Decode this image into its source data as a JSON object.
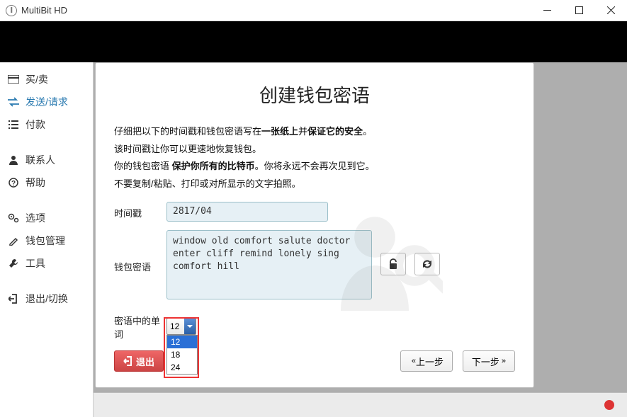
{
  "window": {
    "title": "MultiBit HD"
  },
  "sidebar": {
    "items": [
      {
        "label": "买/卖"
      },
      {
        "label": "发送/请求"
      },
      {
        "label": "付款"
      },
      {
        "label": "联系人"
      },
      {
        "label": "帮助"
      },
      {
        "label": "选项"
      },
      {
        "label": "钱包管理"
      },
      {
        "label": "工具"
      },
      {
        "label": "退出/切换"
      }
    ]
  },
  "dialog": {
    "title": "创建钱包密语",
    "instr1_a": "仔细把以下的时间戳和钱包密语写在",
    "instr1_b": "一张纸上",
    "instr1_c": "并",
    "instr1_d": "保证它的安全",
    "instr1_e": "。",
    "instr2": "该时间戳让你可以更速地恢复钱包。",
    "instr3_a": "你的钱包密语",
    "instr3_b": "保护你所有的比特币",
    "instr3_c": "。你将永远不会再次见到它。",
    "instr4": "不要复制/粘贴、打印或对所显示的文字拍照。",
    "timestamp_label": "时间戳",
    "timestamp_value": "2817/04",
    "seed_label": "钱包密语",
    "seed_value": "window old comfort salute doctor\nenter cliff remind lonely sing\ncomfort hill",
    "wordcount_label": "密语中的单词",
    "wordcount_value": "12",
    "wordcount_options": [
      "12",
      "18",
      "24"
    ],
    "exit_label": "退出",
    "prev_label": "上一步",
    "next_label": "下一步"
  }
}
